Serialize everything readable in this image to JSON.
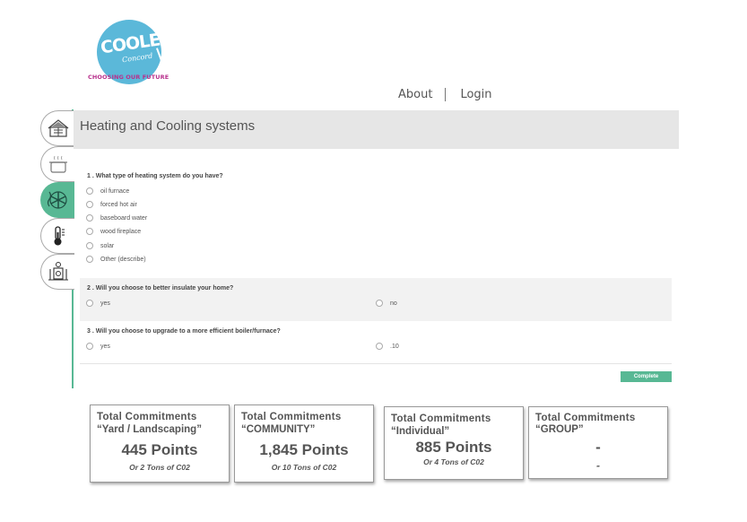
{
  "logo": {
    "line1": "COOLER",
    "line2": "Concord",
    "tagline": "CHOOSING OUR FUTURE"
  },
  "nav": {
    "about": "About",
    "login": "Login"
  },
  "sidebar": {
    "items": [
      {
        "icon": "solar-house-icon",
        "active": false
      },
      {
        "icon": "cooking-pot-icon",
        "active": false
      },
      {
        "icon": "heating-cooling-icon",
        "active": true
      },
      {
        "icon": "thermometer-icon",
        "active": false
      },
      {
        "icon": "appliances-icon",
        "active": false
      }
    ]
  },
  "panel": {
    "title": "Heating and Cooling systems"
  },
  "questions": [
    {
      "label": "1 .  What type of heating system do you have?",
      "options": [
        "oil furnace",
        "forced hot air",
        "baseboard water",
        "wood fireplace",
        "solar",
        "Other (describe)"
      ]
    },
    {
      "label": "2 .  Will you choose to better insulate your home?",
      "options": [
        "yes",
        "no"
      ]
    },
    {
      "label": "3 .  Will you choose to upgrade to a more efficient boiler/furnace?",
      "options": [
        "yes",
        ".10"
      ]
    }
  ],
  "complete_label": "Complete",
  "cards": [
    {
      "line1": "Total  Commitments",
      "line2": "“Yard / Landscaping”",
      "points": "445 Points",
      "sub": "Or 2 Tons of C02"
    },
    {
      "line1": "Total  Commitments",
      "line2": "“COMMUNITY”",
      "points": "1,845 Points",
      "sub": "Or 10 Tons of C02"
    },
    {
      "line1": "Total  Commitments",
      "line2": "“Individual”",
      "points": "885 Points",
      "sub": "Or 4 Tons of C02"
    },
    {
      "line1": "Total  Commitments",
      "line2": "“GROUP”",
      "points": "-",
      "sub": "-"
    }
  ],
  "colors": {
    "accent": "#58b894",
    "logo_blue": "#5bb8d9",
    "logo_magenta": "#b8318d"
  }
}
